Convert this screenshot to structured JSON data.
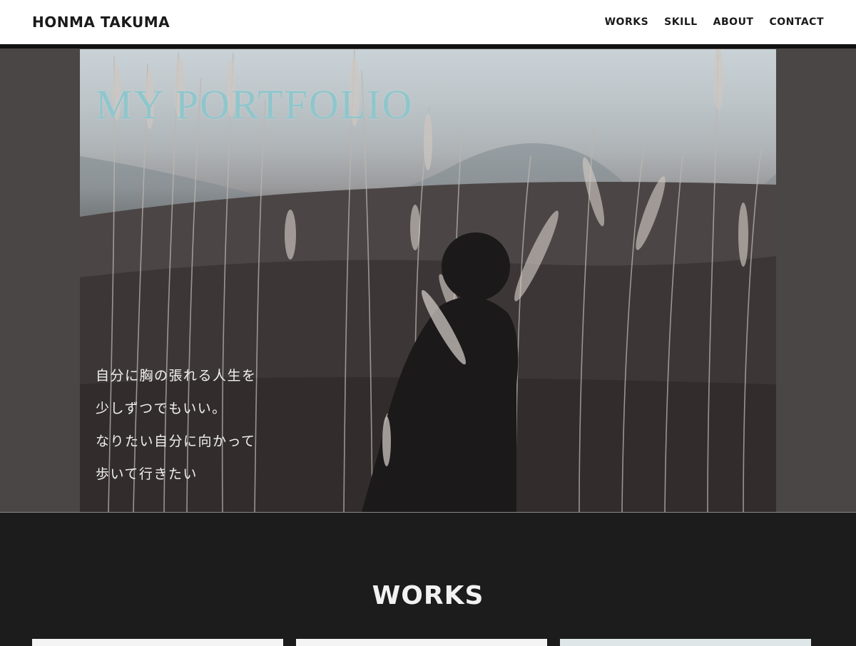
{
  "header": {
    "brand": "HONMA TAKUMA",
    "nav": [
      "WORKS",
      "SKILL",
      "ABOUT",
      "CONTACT"
    ]
  },
  "hero": {
    "title": "MY PORTFOLIO",
    "copy_lines": [
      "自分に胸の張れる人生を",
      "少しずつでもいい。",
      "なりたい自分に向かって",
      "歩いて行きたい"
    ],
    "image": "person-in-pampas-grass-field"
  },
  "works": {
    "title": "WORKS",
    "cards": 3
  },
  "colors": {
    "header_bg": "#ffffff",
    "page_bg": "#1c1c1c",
    "hero_band": "#4a4645",
    "title_accent": "#8fc6cc"
  }
}
